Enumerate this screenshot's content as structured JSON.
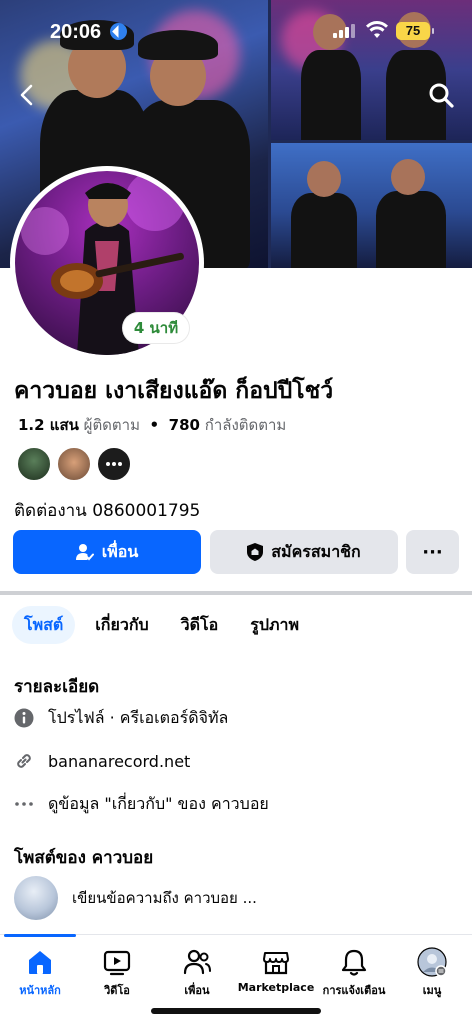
{
  "status_bar": {
    "time": "20:06",
    "battery": "75"
  },
  "profile": {
    "name": "คาวบอย เงาเสียงแอ๊ด ก็อปปีโชว์",
    "followers_count": "1.2 แสน",
    "followers_label": "ผู้ติดตาม",
    "separator": "•",
    "following_count": "780",
    "following_label": "กำลังติดตาม",
    "status_badge": "4 นาที",
    "contact": "ติดต่องาน 0860001795"
  },
  "actions": {
    "friends": "เพื่อน",
    "subscribe": "สมัครสมาชิก",
    "more": "···"
  },
  "tabs": [
    {
      "label": "โพสต์",
      "active": true
    },
    {
      "label": "เกี่ยวกับ",
      "active": false
    },
    {
      "label": "วิดีโอ",
      "active": false
    },
    {
      "label": "รูปภาพ",
      "active": false
    }
  ],
  "details": {
    "title": "รายละเอียด",
    "items": [
      {
        "icon": "info-icon",
        "text": "โปรไฟล์ · ครีเอเตอร์ดิจิทัล"
      },
      {
        "icon": "link-icon",
        "text": "bananarecord.net"
      },
      {
        "icon": "more-icon",
        "text": "ดูข้อมูล \"เกี่ยวกับ\" ของ คาวบอย"
      }
    ]
  },
  "posts": {
    "title": "โพสต์ของ คาวบอย",
    "composer_placeholder": "เขียนข้อความถึง คาวบอย ..."
  },
  "bottom_nav": [
    {
      "label": "หน้าหลัก",
      "icon": "home-icon",
      "active": true
    },
    {
      "label": "วิดีโอ",
      "icon": "video-icon",
      "active": false
    },
    {
      "label": "เพื่อน",
      "icon": "friends-icon",
      "active": false
    },
    {
      "label": "Marketplace",
      "icon": "marketplace-icon",
      "active": false
    },
    {
      "label": "การแจ้งเตือน",
      "icon": "bell-icon",
      "active": false
    },
    {
      "label": "เมนู",
      "icon": "menu-avatar-icon",
      "active": false
    }
  ],
  "colors": {
    "accent": "#0866ff",
    "badge_text": "#2e8b3a",
    "secondary_bg": "#e4e6eb"
  }
}
